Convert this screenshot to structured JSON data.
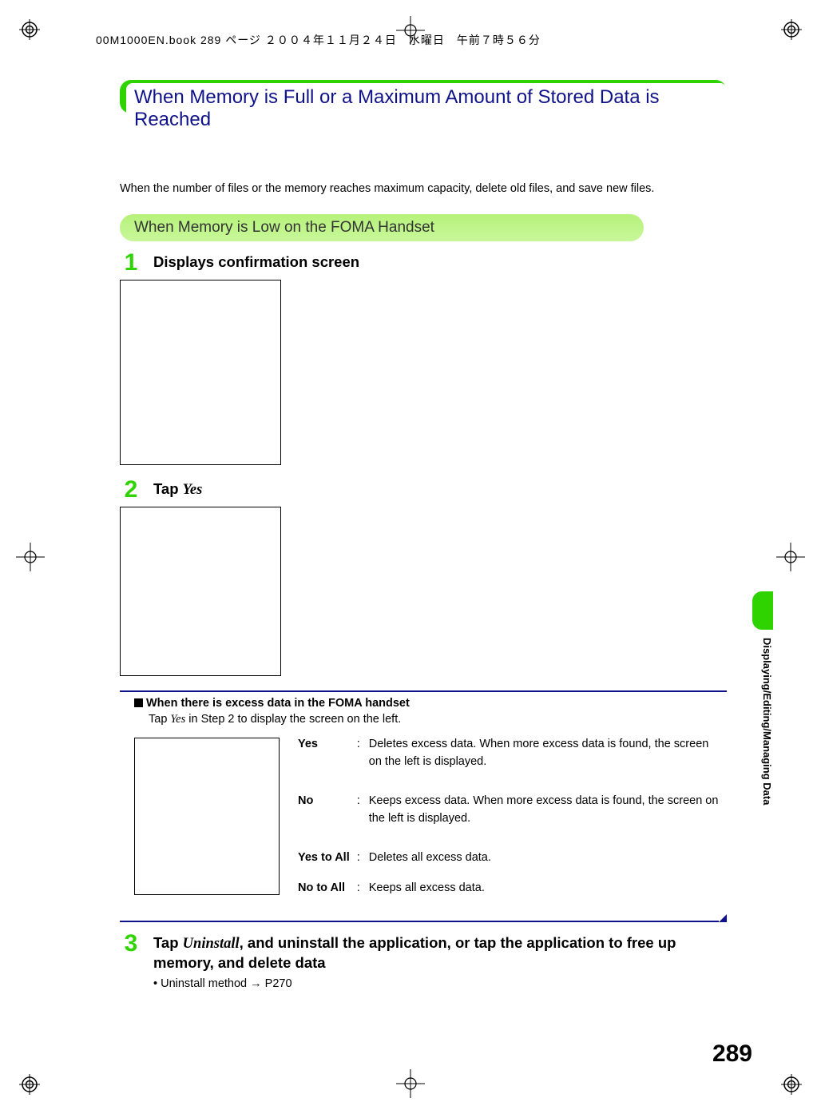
{
  "header": "00M1000EN.book  289 ページ  ２００４年１１月２４日　水曜日　午前７時５６分",
  "title": "When Memory is Full or a Maximum Amount of Stored Data is Reached",
  "intro": "When the number of files or the memory reaches maximum capacity, delete old files, and save new files.",
  "subheading": "When Memory is Low on the FOMA Handset",
  "steps": {
    "s1": {
      "num": "1",
      "title": "Displays confirmation screen"
    },
    "s2": {
      "num": "2",
      "title_pre": "Tap ",
      "title_ital": "Yes"
    },
    "s3": {
      "num": "3",
      "title_pre": "Tap ",
      "title_ital": "Uninstall",
      "title_post": ", and uninstall the application, or tap the application to free up memory, and delete data",
      "bullet": "•  Uninstall method → P270"
    }
  },
  "note": {
    "heading": "When there is excess data in the FOMA handset",
    "sub_pre": "Tap ",
    "sub_ital": "Yes",
    "sub_post": " in Step 2 to display the screen on the left.",
    "defs": {
      "yes": {
        "label": "Yes",
        "text": "Deletes excess data. When more excess data is found, the screen on the left is displayed."
      },
      "no": {
        "label": "No",
        "text": "Keeps excess data. When more excess data is found, the screen on the left is displayed."
      },
      "yes_to_all": {
        "label": "Yes to All",
        "text": "Deletes all excess data."
      },
      "no_to_all": {
        "label": "No to All",
        "text": "Keeps all excess data."
      }
    }
  },
  "side_tab": "Displaying/Editing/Managing Data",
  "page_number": "289"
}
